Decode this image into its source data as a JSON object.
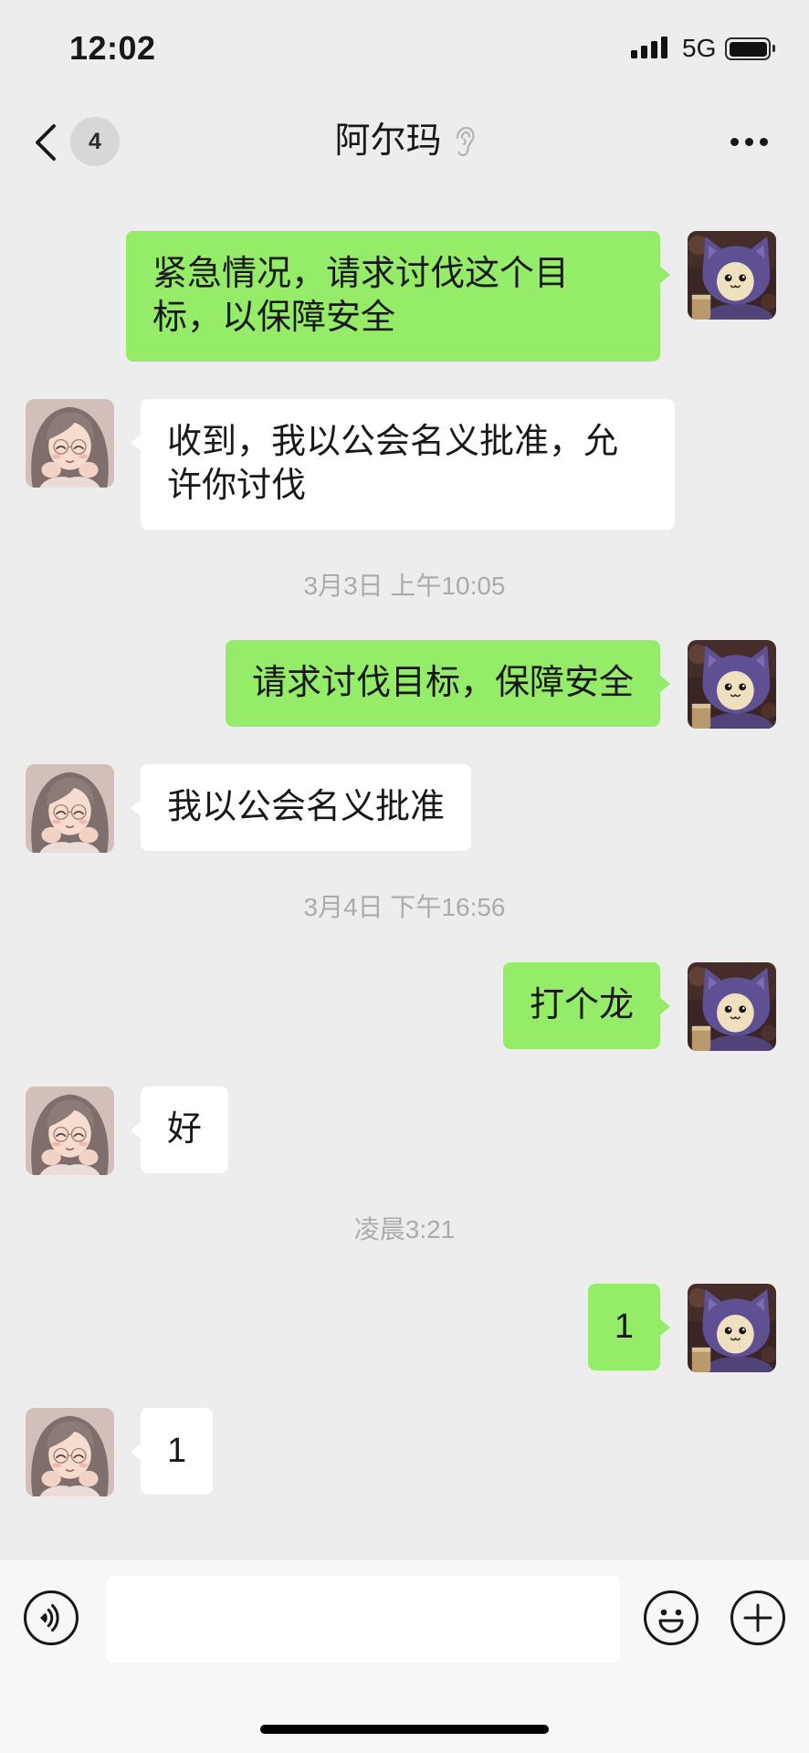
{
  "status_bar": {
    "time": "12:02",
    "network": "5G",
    "signal_bars": 4,
    "battery_level": 1.0
  },
  "header": {
    "unread_badge": "4",
    "title": "阿尔玛",
    "icons": {
      "back": "chevron-left-icon",
      "title_mode": "ear-icon",
      "more": "more-icon"
    }
  },
  "chat": [
    {
      "outgoing": true,
      "text": "紧急情况，请求讨伐这个目标，以保障安全"
    },
    {
      "outgoing": false,
      "text": "收到，我以公会名义批准，允许你讨伐"
    },
    {
      "timestamp": "3月3日 上午10:05"
    },
    {
      "outgoing": true,
      "text": "请求讨伐目标，保障安全"
    },
    {
      "outgoing": false,
      "text": "我以公会名义批准"
    },
    {
      "timestamp": "3月4日 下午16:56"
    },
    {
      "outgoing": true,
      "text": "打个龙"
    },
    {
      "outgoing": false,
      "text": "好"
    },
    {
      "timestamp": "凌晨3:21"
    },
    {
      "outgoing": true,
      "text": "1"
    },
    {
      "outgoing": false,
      "text": "1"
    }
  ],
  "composer": {
    "value": "",
    "icons": {
      "voice": "voice-icon",
      "emoji": "emoji-icon",
      "more": "plus-icon"
    }
  },
  "colors": {
    "background": "#EDEDED",
    "outgoing_bubble": "#95EC69",
    "incoming_bubble": "#FFFFFF",
    "text": "#181818",
    "timestamp": "#ABABAB"
  }
}
